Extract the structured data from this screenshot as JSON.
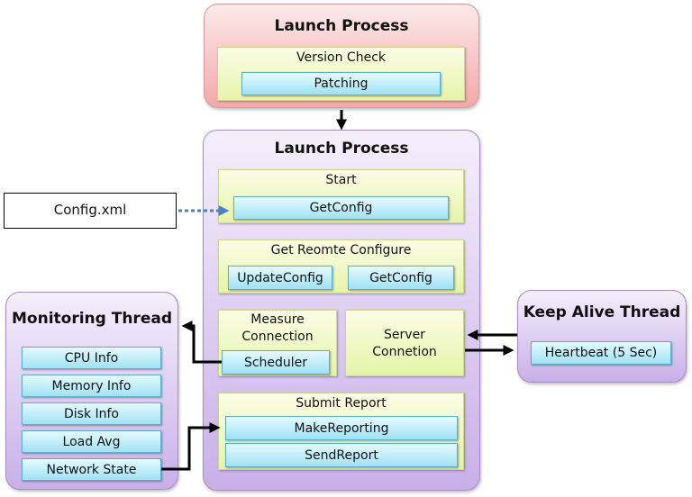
{
  "top_box": {
    "title": "Launch Process",
    "group": "Version Check",
    "items": [
      "Patching"
    ]
  },
  "main_box": {
    "title": "Launch Process",
    "start": {
      "label": "Start",
      "items": [
        "GetConfig"
      ]
    },
    "remote": {
      "label": "Get Reomte Configure",
      "items": [
        "UpdateConfig",
        "GetConfig"
      ]
    },
    "measure": {
      "label_line1": "Measure",
      "label_line2": "Connection",
      "items": [
        "Scheduler"
      ]
    },
    "server": {
      "label_line1": "Server",
      "label_line2": "Connetion"
    },
    "submit": {
      "label": "Submit Report",
      "items": [
        "MakeReporting",
        "SendReport"
      ]
    }
  },
  "config_file": "Config.xml",
  "monitoring": {
    "title": "Monitoring Thread",
    "items": [
      "CPU Info",
      "Memory Info",
      "Disk Info",
      "Load Avg",
      "Network State"
    ]
  },
  "keepalive": {
    "title": "Keep Alive Thread",
    "items": [
      "Heartbeat (5 Sec)"
    ]
  },
  "colors": {
    "arrow": "#000000",
    "dotted_arrow": "#4f7fbf"
  }
}
